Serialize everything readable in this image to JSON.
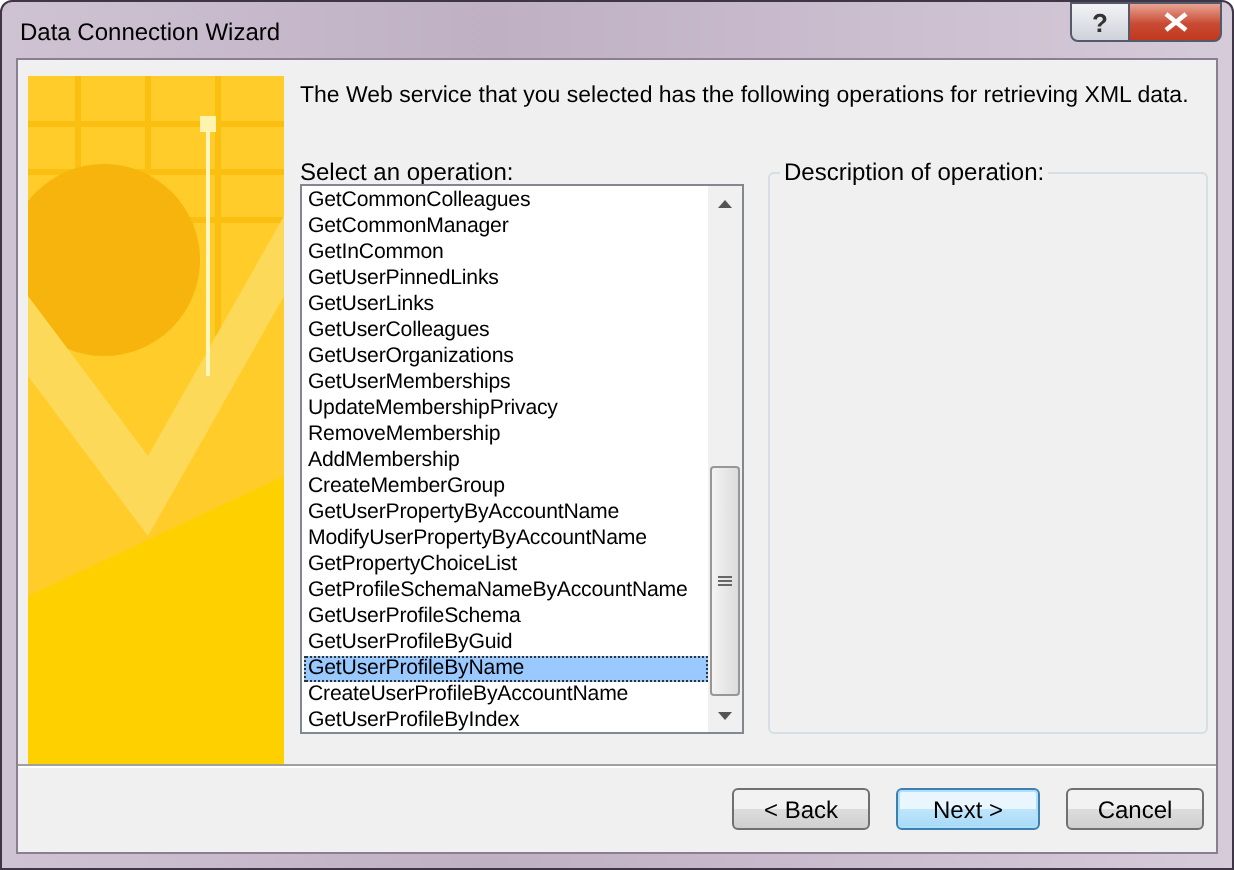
{
  "window": {
    "title": "Data Connection Wizard",
    "title_buttons": [
      {
        "kind": "help",
        "symbol": "?"
      },
      {
        "kind": "close"
      }
    ]
  },
  "intro": "The Web service that you selected has the following operations for retrieving XML data.",
  "operation_list": {
    "label": "Select an operation:",
    "items": [
      {
        "text": "GetCommonColleagues",
        "selected": false
      },
      {
        "text": "GetCommonManager",
        "selected": false
      },
      {
        "text": "GetInCommon",
        "selected": false
      },
      {
        "text": "GetUserPinnedLinks",
        "selected": false
      },
      {
        "text": "GetUserLinks",
        "selected": false
      },
      {
        "text": "GetUserColleagues",
        "selected": false
      },
      {
        "text": "GetUserOrganizations",
        "selected": false
      },
      {
        "text": "GetUserMemberships",
        "selected": false
      },
      {
        "text": "UpdateMembershipPrivacy",
        "selected": false
      },
      {
        "text": "RemoveMembership",
        "selected": false
      },
      {
        "text": "AddMembership",
        "selected": false
      },
      {
        "text": "CreateMemberGroup",
        "selected": false
      },
      {
        "text": "GetUserPropertyByAccountName",
        "selected": false
      },
      {
        "text": "ModifyUserPropertyByAccountName",
        "selected": false
      },
      {
        "text": "GetPropertyChoiceList",
        "selected": false
      },
      {
        "text": "GetProfileSchemaNameByAccountName",
        "selected": false
      },
      {
        "text": "GetUserProfileSchema",
        "selected": false
      },
      {
        "text": "GetUserProfileByGuid",
        "selected": false
      },
      {
        "text": "GetUserProfileByName",
        "selected": true
      },
      {
        "text": "CreateUserProfileByAccountName",
        "selected": false
      },
      {
        "text": "GetUserProfileByIndex",
        "selected": false
      }
    ]
  },
  "description": {
    "label": "Description of operation:"
  },
  "buttons": [
    {
      "label": "< Back",
      "default": false
    },
    {
      "label": "Next >",
      "default": true
    },
    {
      "label": "Cancel",
      "default": false
    }
  ]
}
